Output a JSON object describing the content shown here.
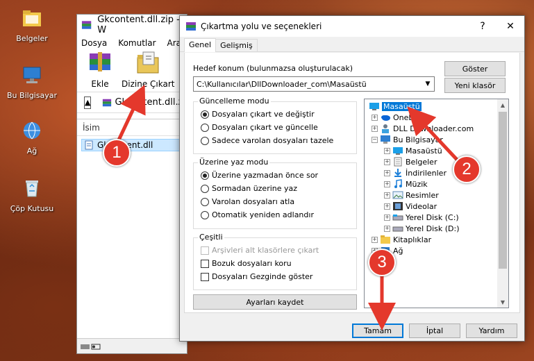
{
  "desktop": {
    "icons": [
      {
        "label": "Belgeler",
        "icon": "folder-icon"
      },
      {
        "label": "Bu Bilgisayar",
        "icon": "computer-icon"
      },
      {
        "label": "Ağ",
        "icon": "network-icon"
      },
      {
        "label": "Çöp Kutusu",
        "icon": "recycle-bin-icon"
      }
    ]
  },
  "winrar": {
    "title": "Gkcontent.dll.zip - W",
    "menu": [
      "Dosya",
      "Komutlar",
      "Araçla"
    ],
    "toolbar": {
      "add_label": "Ekle",
      "extract_label": "Dizine Çıkart"
    },
    "path": "Gkcontent.dll.zip",
    "column_name": "İsim",
    "file": "Gkcontent.dll"
  },
  "dialog": {
    "title": "Çıkartma yolu ve seçenekleri",
    "help_btn": "?",
    "close_btn": "✕",
    "tabs": [
      "Genel",
      "Gelişmiş"
    ],
    "dest_label": "Hedef konum (bulunmazsa oluşturulacak)",
    "dest_value": "C:\\Kullanıcılar\\DllDownloader_com\\Masaüstü",
    "show_btn": "Göster",
    "new_folder_btn": "Yeni klasör",
    "update_group": {
      "label": "Güncelleme modu",
      "options": [
        "Dosyaları çıkart ve değiştir",
        "Dosyaları çıkart ve güncelle",
        "Sadece varolan dosyaları tazele"
      ]
    },
    "overwrite_group": {
      "label": "Üzerine yaz modu",
      "options": [
        "Üzerine yazmadan önce sor",
        "Sormadan üzerine yaz",
        "Varolan dosyaları atla",
        "Otomatik yeniden adlandır"
      ]
    },
    "misc_group": {
      "label": "Çeşitli",
      "options": [
        "Arşivleri alt klasörlere çıkart",
        "Bozuk dosyaları koru",
        "Dosyaları Gezginde göster"
      ]
    },
    "save_btn": "Ayarları kaydet",
    "tree": {
      "root": "Masaüstü",
      "items": [
        "OneDrive",
        "DLL Downloader.com",
        "Bu Bilgisayar",
        "Masaüstü",
        "Belgeler",
        "İndirilenler",
        "Müzik",
        "Resimler",
        "Videolar",
        "Yerel Disk (C:)",
        "Yerel Disk (D:)",
        "Kitaplıklar",
        "Ağ"
      ]
    },
    "ok_btn": "Tamam",
    "cancel_btn": "İptal",
    "help_text_btn": "Yardım"
  },
  "annotations": {
    "step1": "1",
    "step2": "2",
    "step3": "3",
    "color": "#e4382c"
  }
}
